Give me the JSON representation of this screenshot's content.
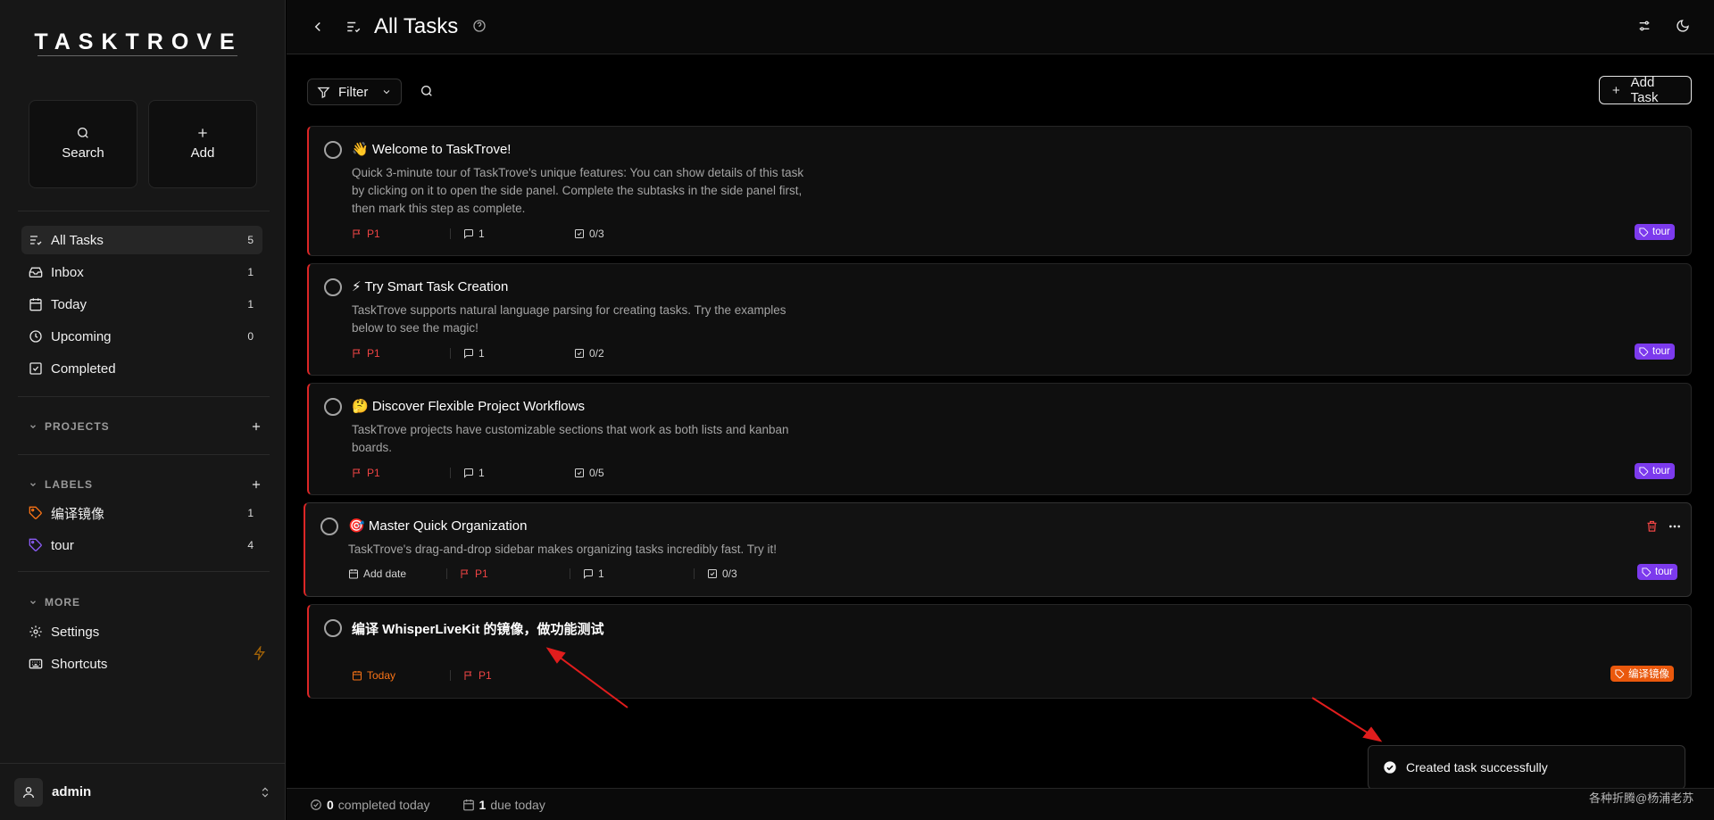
{
  "app": {
    "logo": "TASKTROVE"
  },
  "quick_actions": {
    "search_label": "Search",
    "add_label": "Add"
  },
  "nav": [
    {
      "label": "All Tasks",
      "count": "5",
      "icon": "list-check-icon"
    },
    {
      "label": "Inbox",
      "count": "1",
      "icon": "inbox-icon"
    },
    {
      "label": "Today",
      "count": "1",
      "icon": "calendar-icon"
    },
    {
      "label": "Upcoming",
      "count": "0",
      "icon": "clock-icon"
    },
    {
      "label": "Completed",
      "label_only": true,
      "icon": "check-square-icon"
    }
  ],
  "projects": {
    "heading": "PROJECTS"
  },
  "labels": {
    "heading": "LABELS",
    "items": [
      {
        "label": "编译镜像",
        "count": "1",
        "color": "#f97316"
      },
      {
        "label": "tour",
        "count": "4",
        "color": "#8b5cf6"
      }
    ]
  },
  "more": {
    "heading": "MORE",
    "items": [
      {
        "label": "Settings"
      },
      {
        "label": "Shortcuts"
      }
    ]
  },
  "user": {
    "name": "admin"
  },
  "header": {
    "title": "All Tasks"
  },
  "toolbar": {
    "filter_label": "Filter",
    "add_task_label": "Add Task"
  },
  "tasks": [
    {
      "emoji": "👋",
      "title": "Welcome to TaskTrove!",
      "description": "Quick 3-minute tour of TaskTrove's unique features: You can show details of this task by clicking on it to open the side panel. Complete the subtasks in the side panel first, then mark this step as complete.",
      "priority": "P1",
      "comments": "1",
      "subtasks": "0/3",
      "tag": "tour"
    },
    {
      "emoji": "⚡",
      "title": "Try Smart Task Creation",
      "description": "TaskTrove supports natural language parsing for creating tasks. Try the examples below to see the magic!",
      "priority": "P1",
      "comments": "1",
      "subtasks": "0/2",
      "tag": "tour"
    },
    {
      "emoji": "🤔",
      "title": "Discover Flexible Project Workflows",
      "description": "TaskTrove projects have customizable sections that work as both lists and kanban boards.",
      "priority": "P1",
      "comments": "1",
      "subtasks": "0/5",
      "tag": "tour"
    },
    {
      "emoji": "🎯",
      "title": "Master Quick Organization",
      "description": "TaskTrove's drag-and-drop sidebar makes organizing tasks incredibly fast. Try it!",
      "add_date": "Add date",
      "priority": "P1",
      "comments": "1",
      "subtasks": "0/3",
      "tag": "tour"
    },
    {
      "title": "编译 WhisperLiveKit 的镜像，做功能测试",
      "due": "Today",
      "priority": "P1",
      "tag": "编译镜像"
    }
  ],
  "toast": {
    "message": "Created task successfully"
  },
  "footer": {
    "completed_count": "0",
    "completed_label": "completed today",
    "due_count": "1",
    "due_label": "due today"
  },
  "watermark": "各种折腾@杨浦老苏",
  "colors": {
    "accent_priority": "#dc2626",
    "tag_tour": "#7c3aed",
    "tag_orange": "#ea580c",
    "annotation_arrow": "#e11d1d"
  }
}
